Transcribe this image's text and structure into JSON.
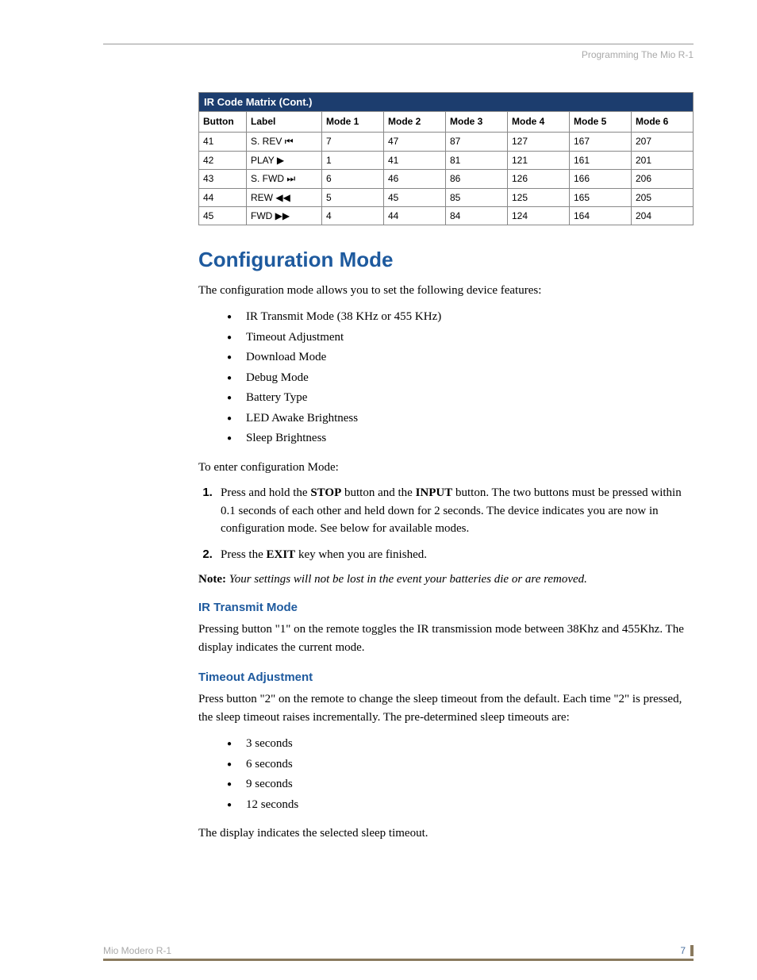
{
  "header": {
    "section": "Programming The Mio R-1"
  },
  "table": {
    "title": "IR Code Matrix (Cont.)",
    "headers": [
      "Button",
      "Label",
      "Mode 1",
      "Mode 2",
      "Mode 3",
      "Mode 4",
      "Mode 5",
      "Mode 6"
    ],
    "rows": [
      {
        "button": "41",
        "label": "S. REV",
        "icon": "skip-prev",
        "m": [
          "7",
          "47",
          "87",
          "127",
          "167",
          "207"
        ]
      },
      {
        "button": "42",
        "label": "PLAY",
        "icon": "play",
        "m": [
          "1",
          "41",
          "81",
          "121",
          "161",
          "201"
        ]
      },
      {
        "button": "43",
        "label": "S. FWD",
        "icon": "skip-next",
        "m": [
          "6",
          "46",
          "86",
          "126",
          "166",
          "206"
        ]
      },
      {
        "button": "44",
        "label": "REW",
        "icon": "rew",
        "m": [
          "5",
          "45",
          "85",
          "125",
          "165",
          "205"
        ]
      },
      {
        "button": "45",
        "label": "FWD",
        "icon": "ffwd",
        "m": [
          "4",
          "44",
          "84",
          "124",
          "164",
          "204"
        ]
      }
    ]
  },
  "config": {
    "title": "Configuration Mode",
    "intro": "The configuration mode allows you to set the following device features:",
    "features": [
      "IR Transmit Mode (38 KHz or 455 KHz)",
      "Timeout Adjustment",
      "Download Mode",
      "Debug Mode",
      "Battery Type",
      "LED Awake Brightness",
      "Sleep Brightness"
    ],
    "enter_label": "To enter configuration Mode:",
    "step1_a": "Press and hold the ",
    "step1_b1": "STOP",
    "step1_c": " button and the ",
    "step1_b2": "INPUT",
    "step1_d": " button. The two buttons must be pressed within 0.1 seconds of each other and held down for 2 seconds. The device indicates you are now in configuration mode. See below for available modes.",
    "step2_a": "Press the ",
    "step2_b": "EXIT",
    "step2_c": " key when you are finished.",
    "note_label": "Note:",
    "note_text": " Your settings will not be lost in the event your batteries die or are removed."
  },
  "ir_transmit": {
    "title": "IR Transmit Mode",
    "body": "Pressing button \"1\" on the remote toggles the IR transmission mode between 38Khz and 455Khz. The display indicates the current mode."
  },
  "timeout": {
    "title": "Timeout Adjustment",
    "intro": "Press button \"2\" on the remote to change the sleep timeout from the default. Each time \"2\" is pressed, the sleep timeout raises incrementally. The pre-determined sleep timeouts are:",
    "items": [
      "3 seconds",
      "6 seconds",
      "9 seconds",
      "12 seconds"
    ],
    "outro": "The display indicates the selected sleep timeout."
  },
  "footer": {
    "doc": "Mio Modero R-1",
    "page": "7"
  },
  "icons": {
    "skip-prev": "⏮",
    "play": "▶",
    "skip-next": "⏭",
    "rew": "◀◀",
    "ffwd": "▶▶"
  }
}
